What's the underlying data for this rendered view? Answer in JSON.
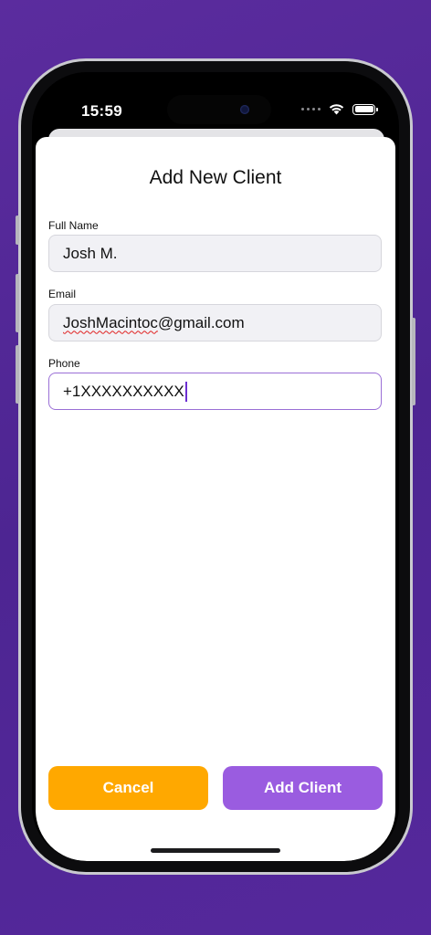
{
  "status_bar": {
    "time": "15:59",
    "icons": [
      "cellular-dots-icon",
      "wifi-icon",
      "battery-icon"
    ]
  },
  "sheet": {
    "title": "Add New Client"
  },
  "form": {
    "full_name": {
      "label": "Full Name",
      "value": "Josh M."
    },
    "email": {
      "label": "Email",
      "value_misspelled": "JoshMacintoc",
      "value_rest": "@gmail.com"
    },
    "phone": {
      "label": "Phone",
      "value": "+1XXXXXXXXXX"
    }
  },
  "actions": {
    "cancel_label": "Cancel",
    "add_label": "Add Client"
  },
  "colors": {
    "background": "#55289c",
    "cancel": "#ffa800",
    "primary": "#9a5ce0",
    "focus_border": "#9a6fd6"
  }
}
